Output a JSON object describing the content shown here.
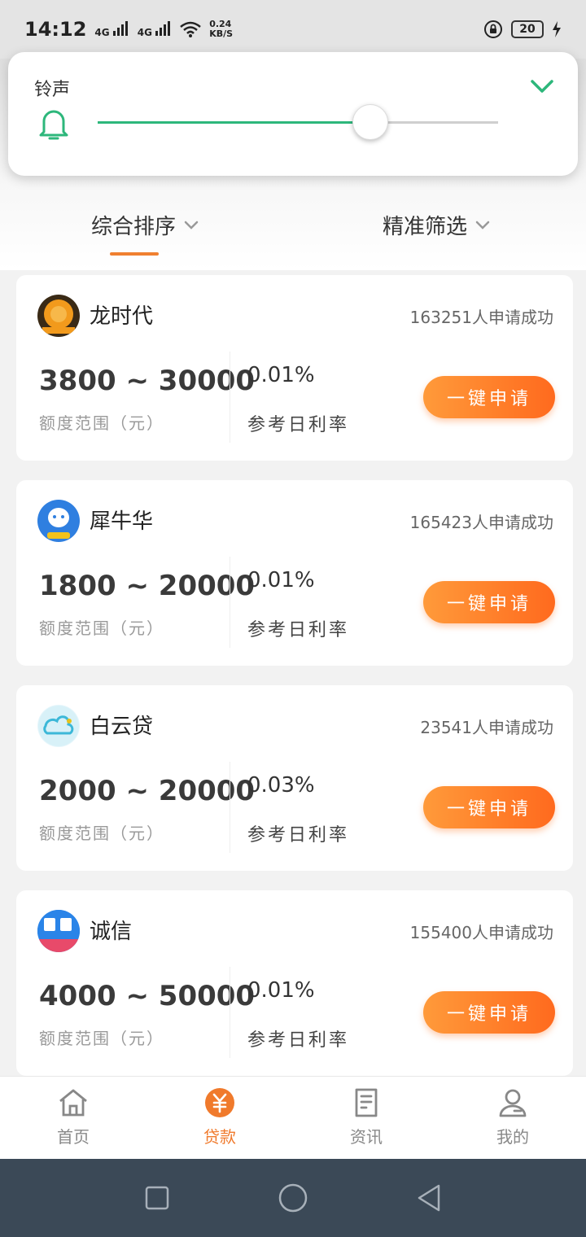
{
  "status_bar": {
    "time": "14:12",
    "signal_1": "4G",
    "signal_2": "4G",
    "speed_value": "0.24",
    "speed_unit": "KB/S",
    "battery": "20"
  },
  "volume_panel": {
    "label": "铃声",
    "level": 0.68,
    "accent_color": "#2db77b"
  },
  "sort_bar": {
    "sort_label": "综合排序",
    "filter_label": "精准筛选"
  },
  "loans": [
    {
      "name": "龙时代",
      "applicants": "163251人申请成功",
      "amount": "3800 ~ 30000",
      "amount_label": "额度范围（元）",
      "rate": "0.01%",
      "rate_label": "参考日利率",
      "button": "一键申请",
      "logo_icon": "dragon-coin-icon",
      "logo_color": "#f29a1c"
    },
    {
      "name": "犀牛华",
      "applicants": "165423人申请成功",
      "amount": "1800 ~ 20000",
      "amount_label": "额度范围（元）",
      "rate": "0.01%",
      "rate_label": "参考日利率",
      "button": "一键申请",
      "logo_icon": "rhino-icon",
      "logo_color": "#2f7fe0"
    },
    {
      "name": "白云贷",
      "applicants": "23541人申请成功",
      "amount": "2000 ~ 20000",
      "amount_label": "额度范围（元）",
      "rate": "0.03%",
      "rate_label": "参考日利率",
      "button": "一键申请",
      "logo_icon": "cloud-icon",
      "logo_color": "#3cb8d8"
    },
    {
      "name": "诚信",
      "applicants": "155400人申请成功",
      "amount": "4000 ~ 50000",
      "amount_label": "额度范围（元）",
      "rate": "0.01%",
      "rate_label": "参考日利率",
      "button": "一键申请",
      "logo_icon": "chengxin-logo-icon",
      "logo_color": "#2a84e8"
    }
  ],
  "bottom_nav": {
    "home": "首页",
    "loan": "贷款",
    "news": "资讯",
    "mine": "我的",
    "active_color": "#f07a2c"
  }
}
